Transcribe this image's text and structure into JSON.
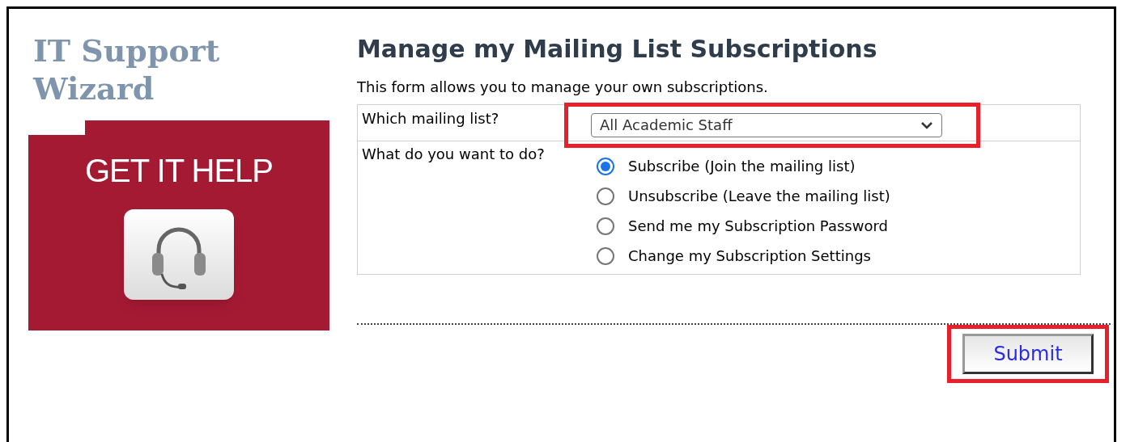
{
  "sidebar": {
    "title_lines": [
      "IT Support",
      "Wizard"
    ],
    "banner": {
      "text": "GET IT HELP"
    }
  },
  "form": {
    "heading": "Manage my Mailing List Subscriptions",
    "description": "This form allows you to manage your own subscriptions.",
    "list_field": {
      "label": "Which mailing list?",
      "value": "All Academic Staff",
      "highlighted": true
    },
    "action_field": {
      "label": "What do you want to do?",
      "options": [
        {
          "label": "Subscribe (Join the mailing list)",
          "selected": true
        },
        {
          "label": "Unsubscribe (Leave the mailing list)",
          "selected": false
        },
        {
          "label": "Send me my Subscription Password",
          "selected": false
        },
        {
          "label": "Change my Subscription Settings",
          "selected": false
        }
      ]
    },
    "submit": {
      "label": "Submit",
      "highlighted": true
    }
  }
}
